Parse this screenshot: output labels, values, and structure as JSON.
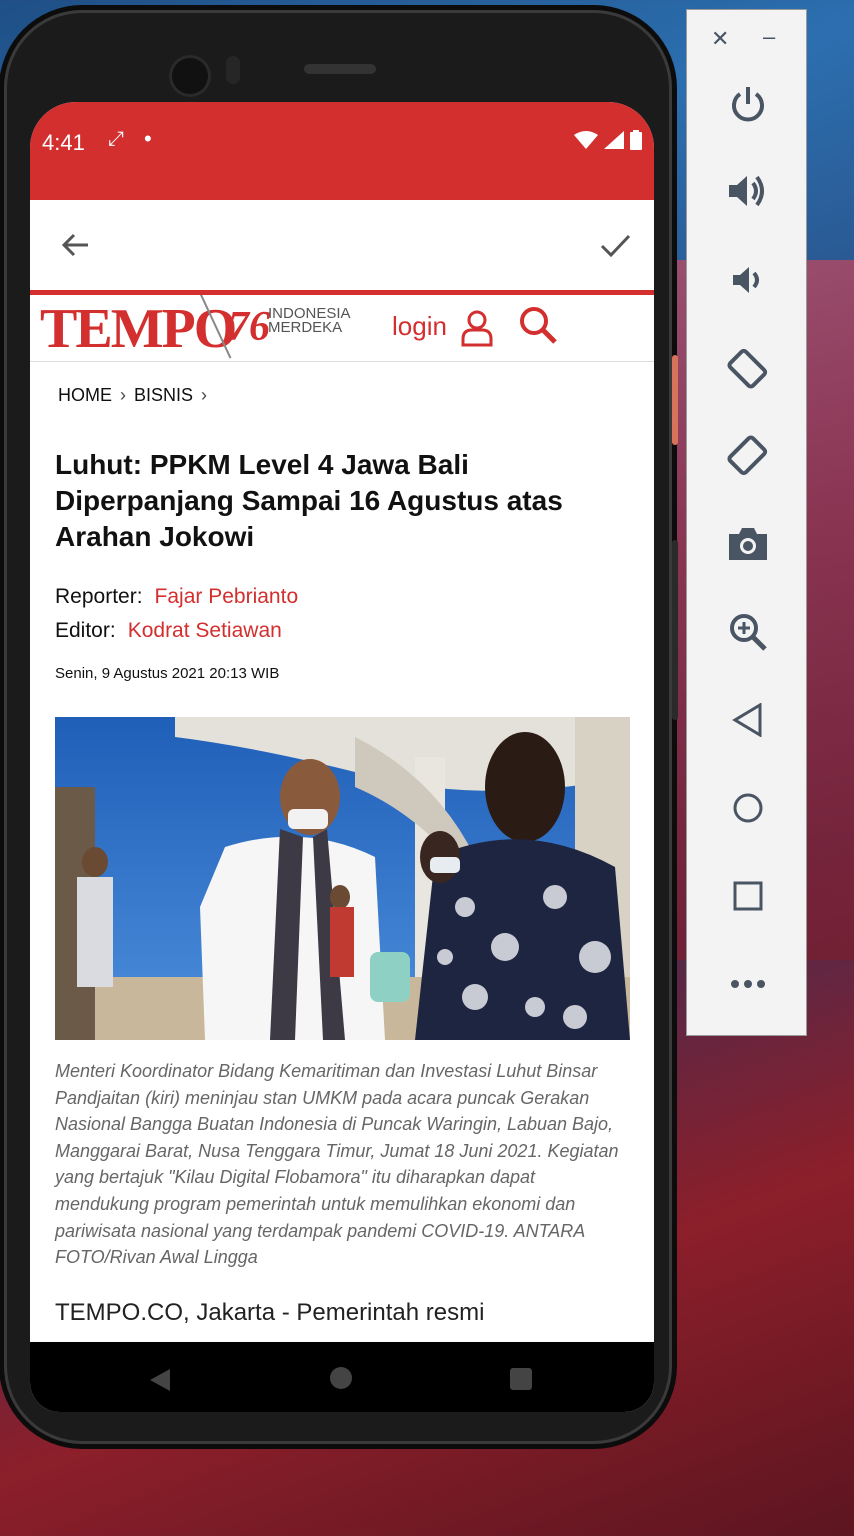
{
  "status_bar": {
    "time": "4:41"
  },
  "site": {
    "logo_text": "TEMPO",
    "anniversary": "76",
    "tagline_line1": "INDONESIA",
    "tagline_line2": "MERDEKA",
    "login_label": "login"
  },
  "breadcrumb": {
    "items": [
      "HOME",
      "BISNIS"
    ]
  },
  "article": {
    "headline": "Luhut: PPKM Level 4 Jawa Bali Diperpanjang Sampai 16 Agustus atas Arahan Jokowi",
    "reporter_label": "Reporter:",
    "reporter_name": "Fajar Pebrianto",
    "editor_label": "Editor:",
    "editor_name": "Kodrat Setiawan",
    "date": "Senin, 9 Agustus 2021 20:13 WIB",
    "caption": "Menteri Koordinator Bidang Kemaritiman dan Investasi Luhut Binsar Pandjaitan (kiri) meninjau stan UMKM pada acara puncak Gerakan Nasional Bangga Buatan Indonesia di Puncak Waringin, Labuan Bajo, Manggarai Barat, Nusa Tenggara Timur, Jumat 18 Juni 2021. Kegiatan yang bertajuk \"Kilau Digital Flobamora\" itu diharapkan dapat mendukung program pemerintah untuk memulihkan ekonomi dan pariwisata nasional yang terdampak pandemi COVID-19. ANTARA FOTO/Rivan Awal Lingga",
    "lead": "TEMPO.CO, Jakarta - Pemerintah resmi"
  },
  "colors": {
    "brand_red": "#d32f2f",
    "status_bar": "#d32f2f"
  },
  "emulator_toolbar": {
    "buttons": [
      "close-icon",
      "minimize-icon",
      "power-icon",
      "volume-up-icon",
      "volume-down-icon",
      "rotate-left-icon",
      "rotate-right-icon",
      "camera-icon",
      "zoom-icon",
      "back-icon",
      "home-icon",
      "overview-icon",
      "more-icon"
    ]
  }
}
